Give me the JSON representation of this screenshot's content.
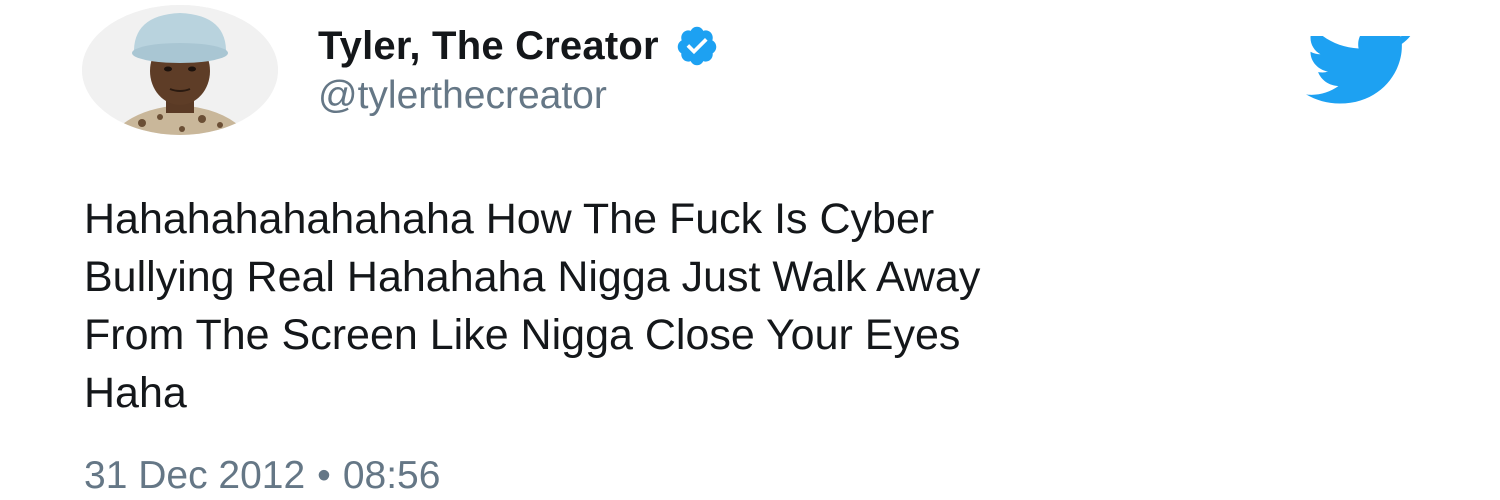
{
  "tweet": {
    "display_name": "Tyler, The Creator",
    "handle": "@tylerthecreator",
    "verified": true,
    "text_lines": [
      "Hahahahahahahaha How The Fuck Is Cyber",
      "Bullying Real Hahahaha Nigga Just Walk Away",
      "From The Screen Like Nigga Close Your Eyes",
      "Haha"
    ],
    "date": "31 Dec 2012",
    "separator": "•",
    "time": "08:56"
  },
  "icons": {
    "verified": "verified-badge-icon",
    "brand": "twitter-bird-icon"
  },
  "colors": {
    "twitter_blue": "#1da1f2",
    "text_primary": "#14171a",
    "text_secondary": "#657786"
  }
}
